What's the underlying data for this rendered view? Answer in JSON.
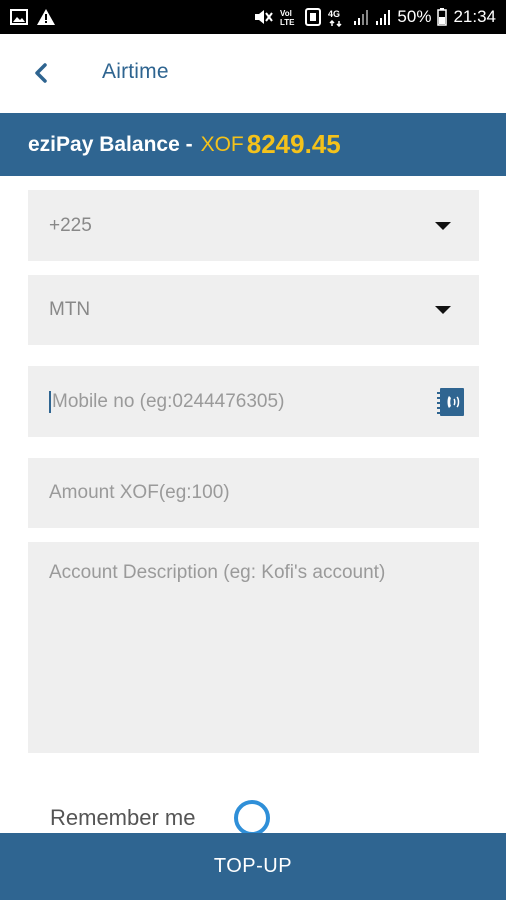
{
  "status_bar": {
    "left_icons": [
      "image-icon",
      "warning-icon"
    ],
    "right_icons": [
      "mute-icon",
      "volte-icon",
      "nfc-icon",
      "4g-icon",
      "signal-icon",
      "signal-icon"
    ],
    "battery": "50%",
    "time": "21:34"
  },
  "app_bar": {
    "title": "Airtime",
    "back_icon": "chevron-left-icon"
  },
  "balance": {
    "label": "eziPay Balance -",
    "currency": "XOF",
    "value": "8249.45"
  },
  "form": {
    "country_code": "+225",
    "network": "MTN",
    "mobile_placeholder": "Mobile no (eg:0244476305)",
    "amount_placeholder": "Amount XOF(eg:100)",
    "description_placeholder": "Account Description (eg: Kofi's account)",
    "remember_label": "Remember me"
  },
  "actions": {
    "topup_label": "TOP-UP"
  },
  "colors": {
    "primary": "#2f6591",
    "accent": "#f4c21b",
    "toggle": "#2f8fd8",
    "field_bg": "#efefef"
  }
}
